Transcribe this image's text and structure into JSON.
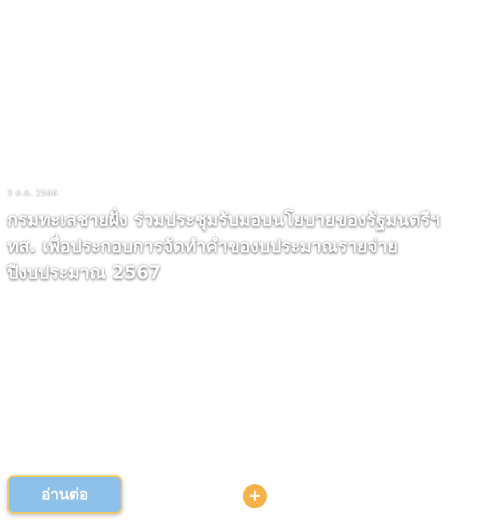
{
  "article": {
    "date": "3 ต.ค. 2566",
    "headline": "กรมทะเลชายฝั่ง ร่วมประชุมรับมอบนโยบายของรัฐมนตรีฯ ทส. เพื่อประกอบการจัดทำคำของบประมาณรายจ่าย ปีงบประมาณ 2567"
  },
  "actions": {
    "read_more_label": "อ่านต่อ",
    "plus_icon": "+"
  },
  "colors": {
    "read_more_bg": "#8ec1ea",
    "read_more_border": "#f4c95d",
    "plus_bg": "#f4b247",
    "text": "#ffffff"
  }
}
